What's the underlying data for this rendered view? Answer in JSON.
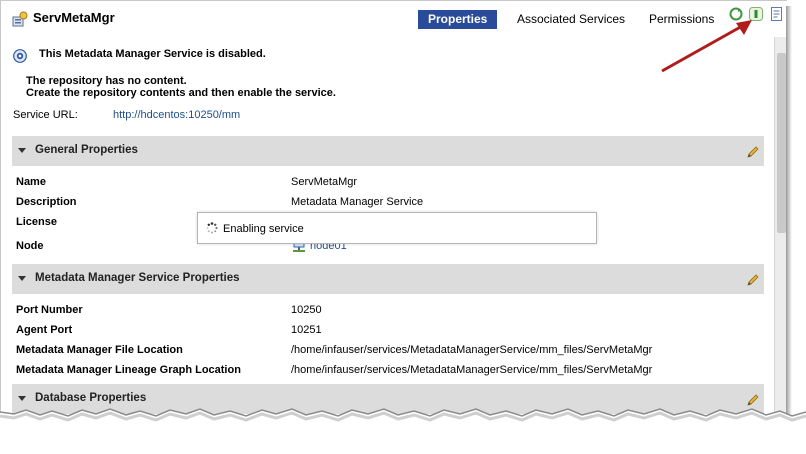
{
  "header": {
    "title": "ServMetaMgr",
    "tabs": [
      {
        "label": "Properties",
        "active": true
      },
      {
        "label": "Associated Services",
        "active": false
      },
      {
        "label": "Permissions",
        "active": false
      }
    ],
    "toolbar_icons": [
      "recycle-icon",
      "enable-service-icon",
      "log-icon"
    ]
  },
  "status": {
    "title": "This Metadata Manager Service is disabled.",
    "lines": [
      "The repository has no content.",
      "Create the repository contents and then enable the service."
    ],
    "url_label": "Service URL:",
    "url_value": "http://hdcentos:10250/mm"
  },
  "sections": {
    "general": {
      "title": "General Properties",
      "rows": [
        {
          "label": "Name",
          "value": "ServMetaMgr"
        },
        {
          "label": "Description",
          "value": "Metadata Manager Service"
        },
        {
          "label": "License",
          "value": ""
        },
        {
          "label": "Node",
          "value": "node01"
        }
      ]
    },
    "mms": {
      "title": "Metadata Manager Service Properties",
      "rows": [
        {
          "label": "Port Number",
          "value": "10250"
        },
        {
          "label": "Agent Port",
          "value": "10251"
        },
        {
          "label": "Metadata Manager File Location",
          "value": "/home/infauser/services/MetadataManagerService/mm_files/ServMetaMgr"
        },
        {
          "label": "Metadata Manager Lineage Graph Location",
          "value": "/home/infauser/services/MetadataManagerService/mm_files/ServMetaMgr"
        }
      ]
    },
    "database": {
      "title": "Database Properties"
    }
  },
  "popup": {
    "text": "Enabling service"
  },
  "colors": {
    "active_tab": "#2a4b9a",
    "link": "#1f4e8c",
    "section_bg": "#dcdcdc",
    "annotation_arrow": "#b01c1c"
  }
}
